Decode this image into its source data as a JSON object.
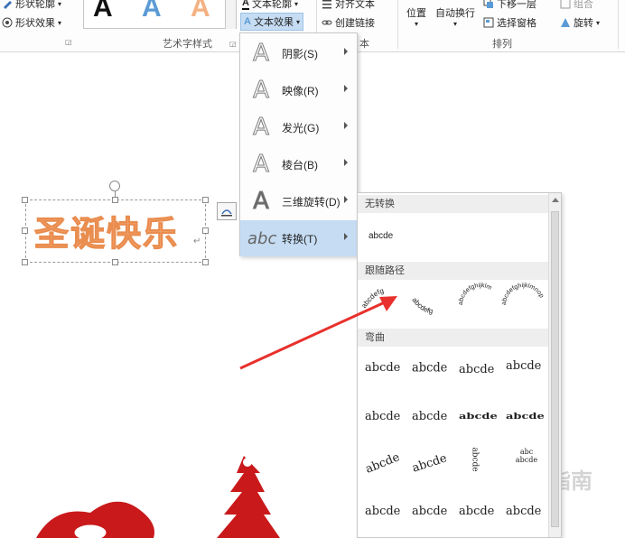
{
  "ribbon": {
    "shape_outline": "形状轮廓",
    "shape_effects": "形状效果",
    "wordart_styles_label": "艺术字样式",
    "text_outline": "文本轮廓",
    "text_effects": "文本效果",
    "align_text": "对齐文本",
    "create_link": "创建链接",
    "text_group_label": "本",
    "position": "位置",
    "wrap_text": "自动换行",
    "send_backward": "下移一层",
    "selection_pane": "选择窗格",
    "group": "组合",
    "rotate": "旋转",
    "arrange_label": "排列",
    "gallery_glyph": "A"
  },
  "document": {
    "wordart_text": "圣诞快乐",
    "watermark": "经验指南"
  },
  "text_effects_menu": {
    "items": [
      {
        "label": "阴影(S)",
        "icon": "A"
      },
      {
        "label": "映像(R)",
        "icon": "A"
      },
      {
        "label": "发光(G)",
        "icon": "A"
      },
      {
        "label": "棱台(B)",
        "icon": "A"
      },
      {
        "label": "三维旋转(D)",
        "icon": "A"
      },
      {
        "label": "转换(T)",
        "icon": "abc"
      }
    ]
  },
  "transform_submenu": {
    "no_transform_header": "无转换",
    "no_transform_sample": "abcde",
    "follow_path_header": "跟随路径",
    "warp_header": "弯曲",
    "follow_path_samples": [
      "abcdefg",
      "abcdefg",
      "abcdefghijklm",
      "abcdefghijklmnop"
    ],
    "warp_row1": [
      "abcde",
      "abcde",
      "abcde",
      "abcde"
    ],
    "warp_row2": [
      "abcde",
      "abcde",
      "abcde",
      "abcde"
    ],
    "warp_row3": [
      "abcde",
      "abcde",
      "abcde",
      "abc abcde"
    ],
    "warp_row4": [
      "abcde",
      "abcde",
      "abcde",
      "abcde"
    ]
  },
  "colors": {
    "wordart_fill": "#f4a46e",
    "menu_highlight": "#c5dcf3",
    "arrow": "#e8302c",
    "tree_red": "#c9191b"
  }
}
